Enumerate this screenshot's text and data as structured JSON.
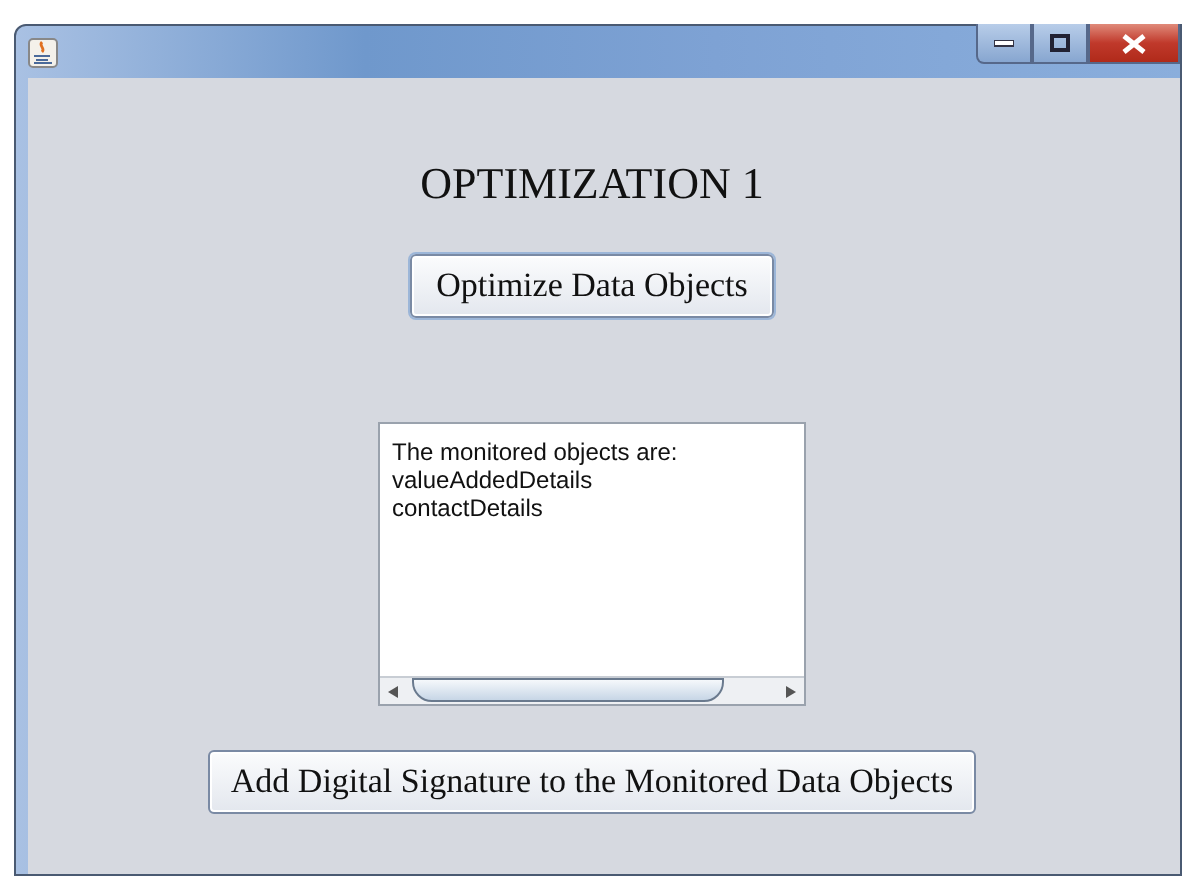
{
  "heading": "OPTIMIZATION 1",
  "optimize_button": "Optimize Data Objects",
  "text_area": {
    "lines": [
      "The monitored objects are:",
      "valueAddedDetails",
      "contactDetails"
    ]
  },
  "signature_button": "Add Digital Signature to the Monitored Data Objects"
}
